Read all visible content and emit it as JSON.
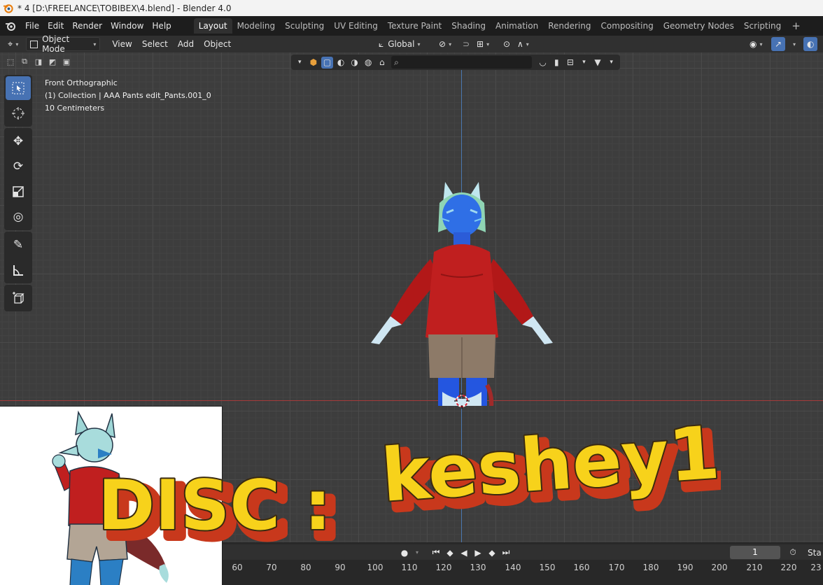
{
  "window": {
    "title": "* 4 [D:\\FREELANCE\\TOBIBEX\\4.blend] - Blender 4.0"
  },
  "menu": {
    "items": [
      "File",
      "Edit",
      "Render",
      "Window",
      "Help"
    ]
  },
  "workspaces": {
    "tabs": [
      "Layout",
      "Modeling",
      "Sculpting",
      "UV Editing",
      "Texture Paint",
      "Shading",
      "Animation",
      "Rendering",
      "Compositing",
      "Geometry Nodes",
      "Scripting"
    ],
    "active": "Layout",
    "add_label": "+"
  },
  "viewport_header": {
    "mode": "Object Mode",
    "menus": [
      "View",
      "Select",
      "Add",
      "Object"
    ],
    "transform_orientation": "Global"
  },
  "viewport": {
    "view_name": "Front Orthographic",
    "collection_info": "(1) Collection | AAA Pants edit_Pants.001_0",
    "grid_scale": "10 Centimeters",
    "search_placeholder": ""
  },
  "toolbar": {
    "tools": [
      "select-box-icon",
      "cursor-icon",
      "move-icon",
      "rotate-icon",
      "scale-icon",
      "transform-icon",
      "annotate-icon",
      "measure-icon",
      "add-cube-icon"
    ],
    "active": "select-box-icon"
  },
  "overlay": {
    "disc_label": "DISC :",
    "handle": "keshey1"
  },
  "timeline": {
    "current_frame": "1",
    "start_label": "Sta",
    "ticks": [
      "60",
      "70",
      "80",
      "90",
      "100",
      "110",
      "120",
      "130",
      "140",
      "150",
      "160",
      "170",
      "180",
      "190",
      "200",
      "210",
      "220",
      "23"
    ]
  },
  "colors": {
    "accent": "#4772b3",
    "x_axis": "#a53a3a",
    "z_axis": "#4b78b0",
    "disc_fill": "#f7d21b",
    "disc_shadow": "#c8381c"
  }
}
